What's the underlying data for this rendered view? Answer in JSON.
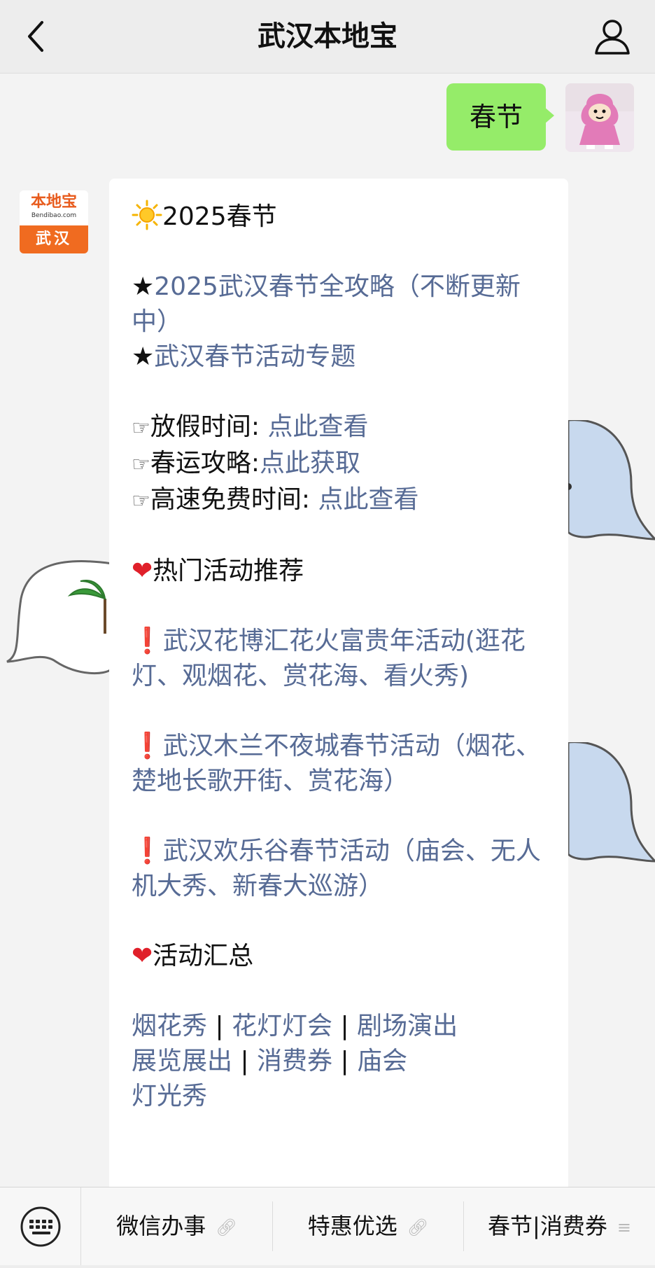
{
  "header": {
    "title": "武汉本地宝"
  },
  "chat": {
    "sent_message": "春节",
    "bot_avatar": {
      "logo_text": "本地宝",
      "site_text": "Bendibao.com",
      "city_text": "武汉"
    },
    "message": {
      "heading_text": "2025春节",
      "star_symbol": "★",
      "guide_link": "2025武汉春节全攻略（不断更新中）",
      "topic_link": "武汉春节活动专题",
      "pointer_symbol": "☞",
      "holiday_label": "放假时间: ",
      "holiday_link": "点此查看",
      "travel_label": "春运攻略:",
      "travel_link": "点此获取",
      "highway_label": "高速免费时间: ",
      "highway_link": "点此查看",
      "heart_symbol": "❤",
      "hot_title": "热门活动推荐",
      "exclaim_symbol": "❗",
      "hot_items": [
        "武汉花博汇花火富贵年活动(逛花灯、观烟花、赏花海、看火秀)",
        "武汉木兰不夜城春节活动（烟花、楚地长歌开街、赏花海）",
        "武汉欢乐谷春节活动（庙会、无人机大秀、新春大巡游）"
      ],
      "summary_title": "活动汇总",
      "separator": " | ",
      "summary_links": [
        "烟花秀",
        "花灯灯会",
        "剧场演出",
        "展览展出",
        "消费券",
        "庙会",
        "灯光秀"
      ]
    }
  },
  "bottom_menu": {
    "items": [
      "微信办事",
      "特惠优选",
      "春节|消费券"
    ],
    "link_icon": "link-icon",
    "list_icon": "menu-lines-icon"
  },
  "colors": {
    "sent_bubble": "#95ec69",
    "link": "#576b95",
    "brand_orange": "#f06b20",
    "heart_red": "#e0202a"
  }
}
